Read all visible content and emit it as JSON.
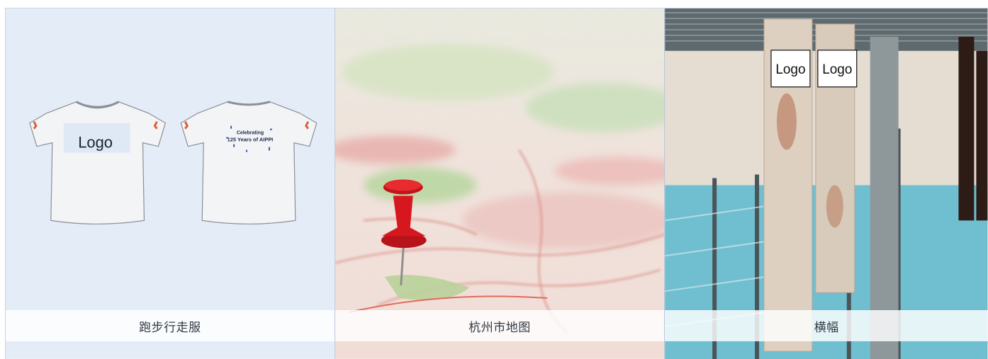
{
  "cards": [
    {
      "caption": "跑步行走服",
      "image": "tshirt-mockup",
      "logo_text": "Logo",
      "print_line1": "Celebrating",
      "print_line2": "125 Years of AIPPI",
      "background": "#e4ecf8"
    },
    {
      "caption": "杭州市地图",
      "image": "map-with-red-pushpin"
    },
    {
      "caption": "横幅",
      "image": "hanging-banners",
      "logo_text_1": "Logo",
      "logo_text_2": "Logo"
    }
  ]
}
